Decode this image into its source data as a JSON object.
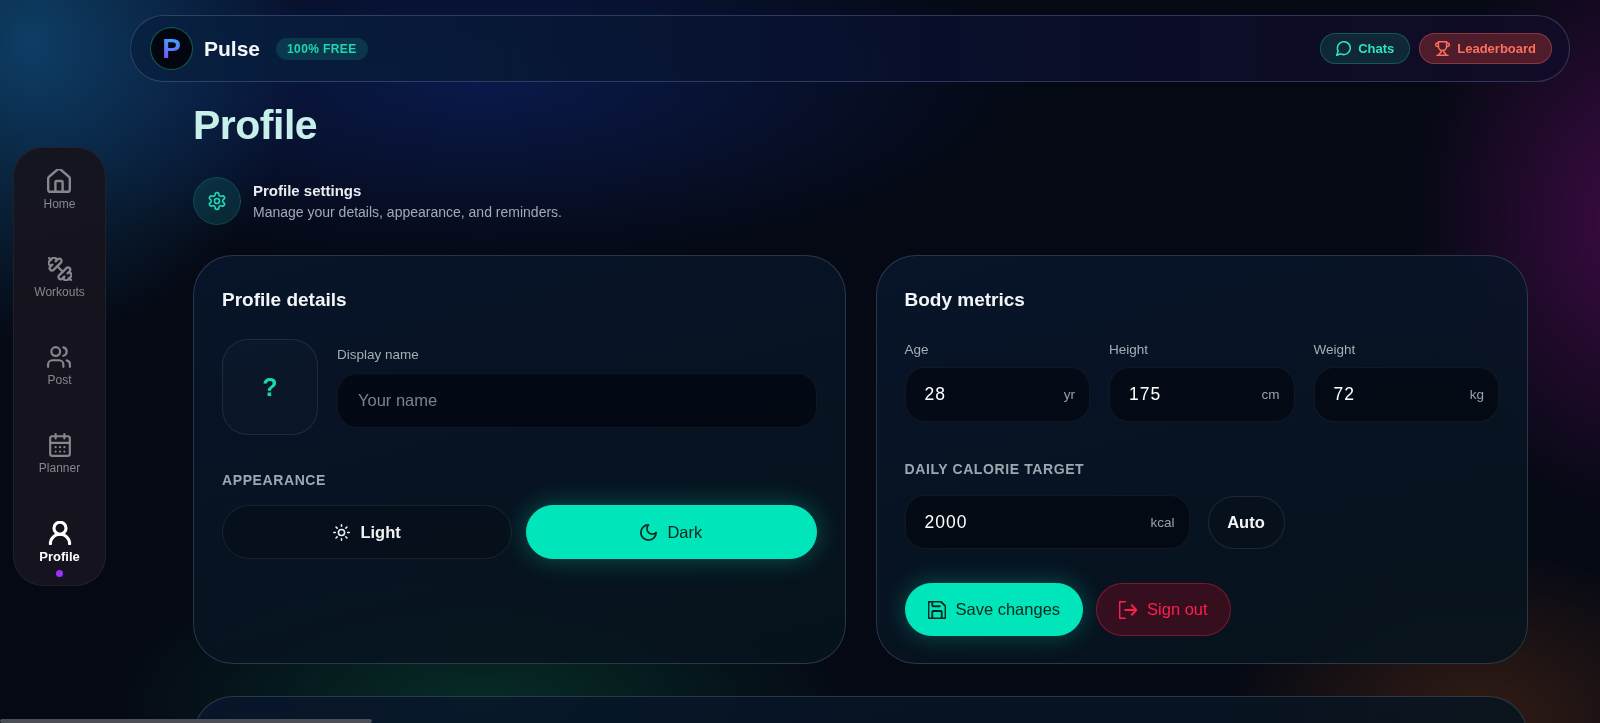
{
  "header": {
    "logo": "P",
    "brand": "Pulse",
    "badge": "100% FREE",
    "actions": [
      {
        "kind": "chats",
        "label": "Chats"
      },
      {
        "kind": "leaderboard",
        "label": "Leaderboard"
      }
    ]
  },
  "sidebar": {
    "items": [
      {
        "kind": "home",
        "label": "Home",
        "selected": false
      },
      {
        "kind": "workouts",
        "label": "Workouts",
        "selected": false
      },
      {
        "kind": "post",
        "label": "Post",
        "selected": false
      },
      {
        "kind": "planner",
        "label": "Planner",
        "selected": false
      },
      {
        "kind": "profile",
        "label": "Profile",
        "selected": true
      }
    ]
  },
  "page": {
    "title": "Profile"
  },
  "settings_intro": {
    "title": "Profile settings",
    "subtitle": "Manage your details, appearance, and reminders."
  },
  "profile_details": {
    "title": "Profile details",
    "avatar": "?",
    "display_name": {
      "label": "Display name",
      "placeholder": "Your name"
    },
    "appearance": {
      "label": "APPEARANCE",
      "options": [
        {
          "kind": "light",
          "label": "Light",
          "selected": false
        },
        {
          "kind": "dark",
          "label": "Dark",
          "selected": true
        }
      ]
    }
  },
  "body_metrics": {
    "title": "Body metrics",
    "fields": [
      {
        "label": "Age",
        "value": "28",
        "unit": "yr"
      },
      {
        "label": "Height",
        "value": "175",
        "unit": "cm"
      },
      {
        "label": "Weight",
        "value": "72",
        "unit": "kg"
      }
    ],
    "calorie_target": {
      "label": "DAILY CALORIE TARGET",
      "value": "2000",
      "unit": "kcal",
      "button": "Auto"
    },
    "actions": [
      {
        "kind": "save",
        "label": "Save changes"
      },
      {
        "kind": "sign_out",
        "label": "Sign out"
      }
    ]
  }
}
